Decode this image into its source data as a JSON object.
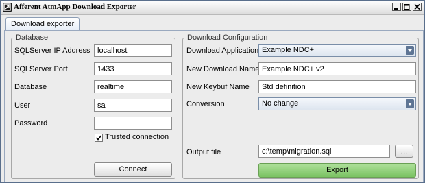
{
  "window": {
    "title": "Afferent AtmApp Download Exporter"
  },
  "tabs": [
    {
      "label": "Download exporter"
    }
  ],
  "database": {
    "legend": "Database",
    "ip_label": "SQLServer IP Address",
    "ip_value": "localhost",
    "port_label": "SQLServer Port",
    "port_value": "1433",
    "db_label": "Database",
    "db_value": "realtime",
    "user_label": "User",
    "user_value": "sa",
    "password_label": "Password",
    "password_value": "",
    "trusted_label": "Trusted connection",
    "trusted_checked": true,
    "connect_label": "Connect"
  },
  "download": {
    "legend": "Download Configuration",
    "app_label": "Download Application",
    "app_value": "Example NDC+",
    "new_name_label": "New Download Name",
    "new_name_value": "Example NDC+ v2",
    "keybuf_label": "New Keybuf Name",
    "keybuf_value": "Std definition",
    "conversion_label": "Conversion",
    "conversion_value": "No change",
    "output_label": "Output file",
    "output_value": "c:\\temp\\migration.sql",
    "browse_label": "...",
    "export_label": "Export"
  },
  "colors": {
    "export_button": "#7bc363",
    "title_bar": "#dcdcdc",
    "combo_arrow": "#5e7594"
  },
  "icons": {
    "app": "app-icon",
    "minimize": "minimize-icon",
    "maximize": "maximize-icon",
    "close": "close-icon",
    "dropdown": "chevron-down-icon",
    "checkbox": "checkmark-icon"
  }
}
